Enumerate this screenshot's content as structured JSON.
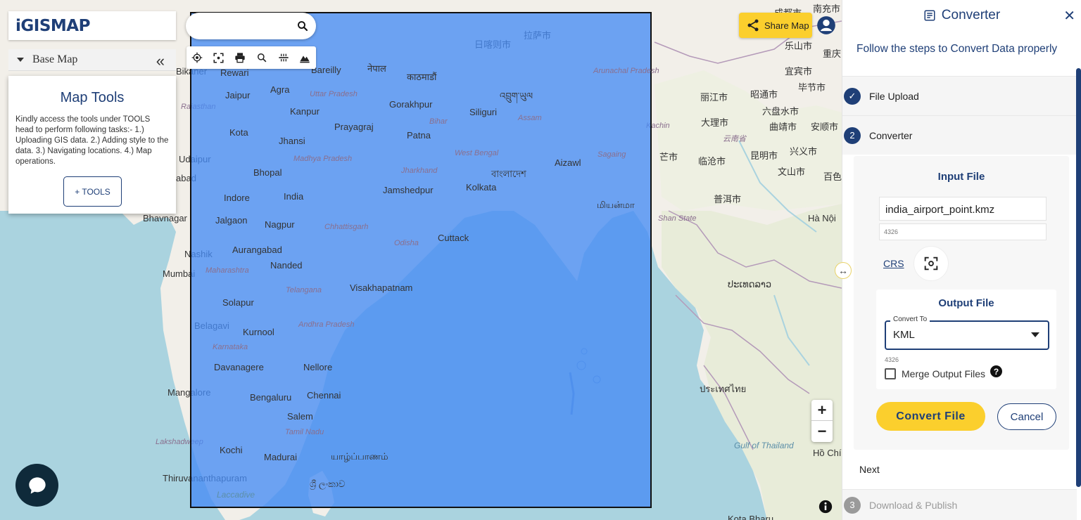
{
  "logo": {
    "text": "iGISMAP"
  },
  "search": {
    "placeholder": ""
  },
  "base_map": {
    "label": "Base Map",
    "collapse": "«"
  },
  "map_tools": {
    "title": "Map Tools",
    "description": "Kindly access the tools under TOOLS head to perform following tasks:- 1.) Uploading GIS data. 2.) Adding style to the data. 3.) Navigating locations. 4.) Map operations.",
    "button_label": "+ TOOLS"
  },
  "toolbar_icons": [
    "locate-icon",
    "fullscreen-icon",
    "print-icon",
    "zoom-search-icon",
    "measure-icon",
    "terrain-icon"
  ],
  "share": {
    "label": "Share Map"
  },
  "zoom": {
    "in": "+",
    "out": "−"
  },
  "map_labels": [
    {
      "t": "Rewari"
    },
    {
      "t": "Bareilly"
    },
    {
      "t": "नेपाल"
    },
    {
      "t": "काठमाडौं"
    },
    {
      "t": "日喀则市"
    },
    {
      "t": "拉萨市"
    },
    {
      "t": "Jaipur"
    },
    {
      "t": "Agra"
    },
    {
      "t": "Uttar Pradesh"
    },
    {
      "t": "Gorakhpur"
    },
    {
      "t": "Siliguri"
    },
    {
      "t": "འབྲུག་ཡུལ"
    },
    {
      "t": "Kanpur"
    },
    {
      "t": "Prayagraj"
    },
    {
      "t": "Patna"
    },
    {
      "t": "Bihar"
    },
    {
      "t": "Assam"
    },
    {
      "t": "Kota"
    },
    {
      "t": "Jhansi"
    },
    {
      "t": "Madhya Pradesh"
    },
    {
      "t": "West Bengal"
    },
    {
      "t": "Bhopal"
    },
    {
      "t": "Jharkhand"
    },
    {
      "t": "বাংলাদেশ"
    },
    {
      "t": "Aizawl"
    },
    {
      "t": "Indore"
    },
    {
      "t": "India"
    },
    {
      "t": "Jamshedpur"
    },
    {
      "t": "Kolkata"
    },
    {
      "t": "Jalgaon"
    },
    {
      "t": "Nagpur"
    },
    {
      "t": "Chhattisgarh"
    },
    {
      "t": "Cuttack"
    },
    {
      "t": "Odisha"
    },
    {
      "t": "Nashik"
    },
    {
      "t": "Aurangabad"
    },
    {
      "t": "Nanded"
    },
    {
      "t": "Maharashtra"
    },
    {
      "t": "Mumbai"
    },
    {
      "t": "Telangana"
    },
    {
      "t": "Visakhapatnam"
    },
    {
      "t": "Solapur"
    },
    {
      "t": "Belagavi"
    },
    {
      "t": "Kurnool"
    },
    {
      "t": "Andhra Pradesh"
    },
    {
      "t": "Karnataka"
    },
    {
      "t": "Davanagere"
    },
    {
      "t": "Nellore"
    },
    {
      "t": "Mangalore"
    },
    {
      "t": "Bengaluru"
    },
    {
      "t": "Chennai"
    },
    {
      "t": "Salem"
    },
    {
      "t": "Tamil Nadu"
    },
    {
      "t": "Lakshadweep"
    },
    {
      "t": "Kochi"
    },
    {
      "t": "Madurai"
    },
    {
      "t": "Thiruvananthapuram"
    },
    {
      "t": "Laccadive"
    },
    {
      "t": "Bikaner"
    },
    {
      "t": "Rajasthan"
    },
    {
      "t": "Udaipur"
    },
    {
      "t": "abad"
    },
    {
      "t": "Bhavnagar"
    },
    {
      "t": "丽江市"
    },
    {
      "t": "大理市"
    },
    {
      "t": "云南省"
    },
    {
      "t": "昆明市"
    },
    {
      "t": "临沧市"
    },
    {
      "t": "普洱市"
    },
    {
      "t": "昭通市"
    },
    {
      "t": "六盘水市"
    },
    {
      "t": "曲靖市"
    },
    {
      "t": "安顺市"
    },
    {
      "t": "宜宾市"
    },
    {
      "t": "毕节市"
    },
    {
      "t": "乐山市"
    },
    {
      "t": "成都市"
    },
    {
      "t": "南充市"
    },
    {
      "t": "重庆"
    },
    {
      "t": "文山市"
    },
    {
      "t": "兴义市"
    },
    {
      "t": "百色"
    },
    {
      "t": "芒市"
    },
    {
      "t": "Shan State"
    },
    {
      "t": "Hà Nội"
    },
    {
      "t": "ປະເທດລາວ"
    },
    {
      "t": "ประเทศไทย"
    },
    {
      "t": "Gulf of Thailand"
    },
    {
      "t": "Hồ Chí"
    },
    {
      "t": "Kota Bharu"
    },
    {
      "t": "Arunachal Pradesh"
    },
    {
      "t": "Kachin"
    },
    {
      "t": "Sagaing"
    },
    {
      "t": "மியன்மா"
    },
    {
      "t": "ශ්‍රී ලංකාව"
    },
    {
      "t": "யாழ்ப்பாணம்"
    }
  ],
  "panel": {
    "title": "Converter",
    "close": "✕",
    "subtitle": "Follow the steps to Convert Data properly",
    "steps": [
      {
        "num": "✓",
        "label": "File Upload",
        "state": "done"
      },
      {
        "num": "2",
        "label": "Converter",
        "state": "active"
      },
      {
        "num": "3",
        "label": "Download & Publish",
        "state": "disabled"
      }
    ],
    "input": {
      "heading": "Input File",
      "filename": "india_airport_point.kmz",
      "epsg": "4326",
      "crs_label": "CRS"
    },
    "output": {
      "heading": "Output File",
      "convert_to_label": "Convert To",
      "format": "KML",
      "epsg": "4326",
      "merge_label": "Merge Output Files",
      "help": "?"
    },
    "convert_button": "Convert File",
    "cancel_button": "Cancel",
    "next_label": "Next"
  },
  "colors": {
    "brand": "#1f3f77",
    "accent": "#fbcf2d",
    "extent": "#468cf5"
  }
}
